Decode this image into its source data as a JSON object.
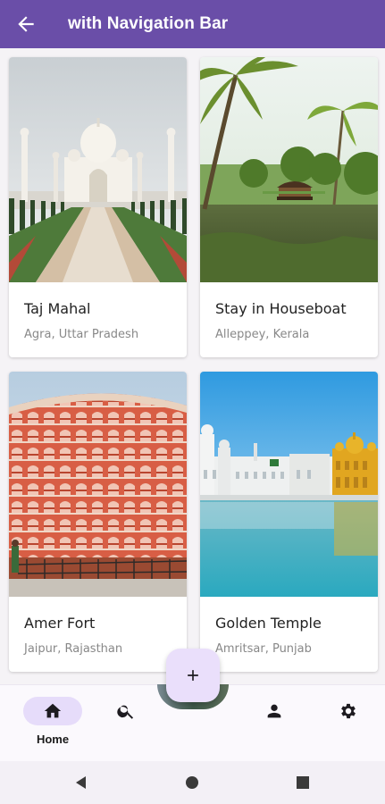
{
  "app_bar": {
    "title": "with Navigation Bar",
    "back_icon": "arrow-back-icon"
  },
  "places": [
    {
      "title": "Taj Mahal",
      "subtitle": "Agra, Uttar Pradesh"
    },
    {
      "title": "Stay in Houseboat",
      "subtitle": "Alleppey, Kerala"
    },
    {
      "title": "Amer Fort",
      "subtitle": "Jaipur, Rajasthan"
    },
    {
      "title": "Golden Temple",
      "subtitle": "Amritsar, Punjab"
    }
  ],
  "fab": {
    "icon": "plus-icon"
  },
  "bottom_nav": {
    "items": [
      {
        "label": "Home",
        "icon": "home-icon",
        "active": true
      },
      {
        "label": "",
        "icon": "search-icon"
      },
      {
        "label": "",
        "icon": "person-icon"
      },
      {
        "label": "",
        "icon": "gear-icon"
      }
    ]
  },
  "colors": {
    "primary": "#6a4ea8",
    "nav_active": "#e6dcfa",
    "fab": "#eadffb"
  }
}
